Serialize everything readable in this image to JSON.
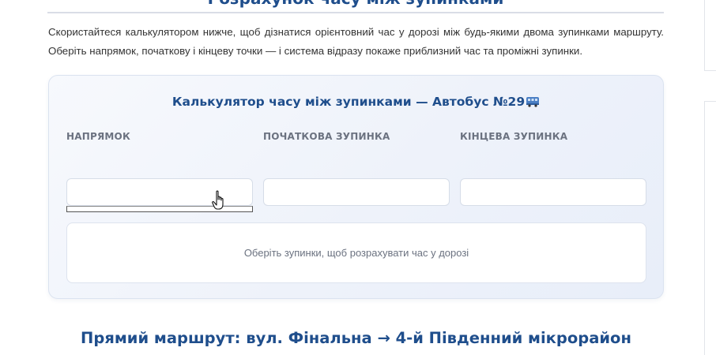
{
  "page": {
    "top_heading": "Розрахунок часу між зупинками",
    "intro": "Скористайтеся калькулятором нижче, щоб дізнатися орієнтовний час у дорозі між будь-якими двома зупинками маршруту. Оберіть напрямок, початкову і кінцеву точки — і система відразу покаже приблизний час та проміжні зупинки."
  },
  "calculator": {
    "title": "Калькулятор часу між зупинками — Автобус №29",
    "title_icon": "bus-icon",
    "fields": [
      {
        "label": "НАПРЯМОК",
        "value": ""
      },
      {
        "label": "ПОЧАТКОВА ЗУПИНКА",
        "value": ""
      },
      {
        "label": "КІНЦЕВА ЗУПИНКА",
        "value": ""
      }
    ],
    "result_placeholder": "Оберіть зупинки, щоб розрахувати час у дорозі"
  },
  "route": {
    "heading": "Прямий маршрут: вул. Фінальна → 4-й Південний мікрорайон"
  },
  "colors": {
    "accent": "#1f4e8c",
    "label": "#6b7280",
    "card_border": "#dbe3f0"
  }
}
